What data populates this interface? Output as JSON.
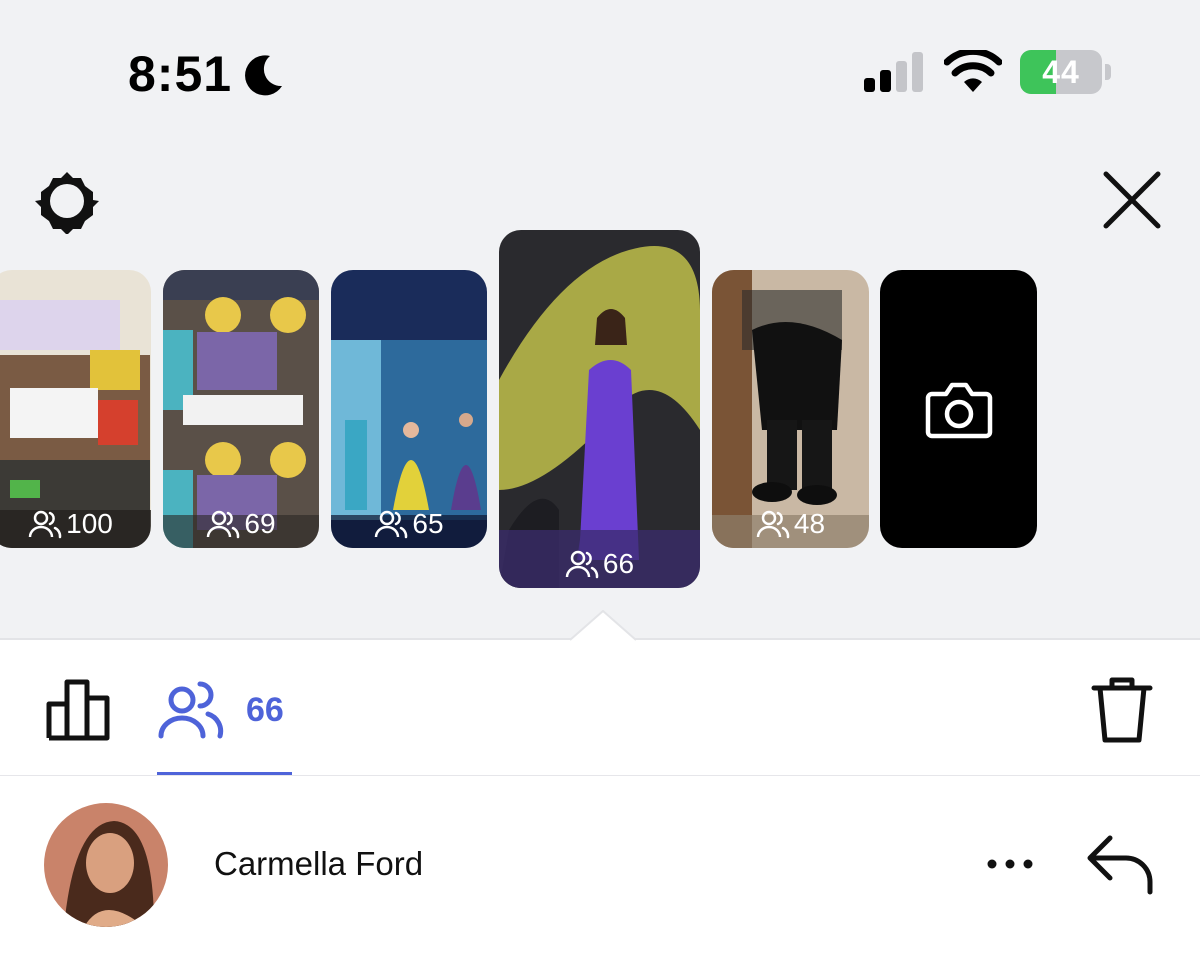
{
  "status_bar": {
    "time": "8:51",
    "battery_percent": "44",
    "battery_level": 0.44,
    "icons": [
      "moon-icon",
      "cellular-signal-icon",
      "wifi-icon",
      "battery-charging-icon"
    ]
  },
  "header": {
    "settings_icon": "gear-icon",
    "close_icon": "close-icon"
  },
  "stories": [
    {
      "viewers": "100",
      "selected": false
    },
    {
      "viewers": "69",
      "selected": false
    },
    {
      "viewers": "65",
      "selected": false
    },
    {
      "viewers": "66",
      "selected": true
    },
    {
      "viewers": "48",
      "selected": false
    },
    {
      "type": "camera",
      "icon": "camera-icon"
    }
  ],
  "tabs": {
    "insights_icon": "bar-chart-icon",
    "viewers_icon": "people-icon",
    "viewers_count": "66",
    "delete_icon": "trash-icon"
  },
  "viewers_list": [
    {
      "name": "Carmella Ford",
      "more_icon": "more-icon",
      "reply_icon": "reply-icon"
    }
  ],
  "colors": {
    "accent": "#4e63d9",
    "battery_green": "#3ec45a",
    "top_background": "#f1f2f4"
  }
}
